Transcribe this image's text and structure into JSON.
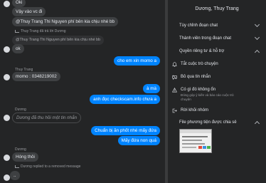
{
  "chat": {
    "messages": [
      {
        "text": "Oki"
      },
      {
        "text": "Vậy vào vc đi"
      },
      {
        "text": "@Thuy Trang Thi Nguyen phí bên kia chịu nhé bb"
      },
      {
        "meta": "Thuy Trang đã trả lời Dương"
      },
      {
        "quote": "@Thuy Trang Thi Nguyen phí bên kia chịu nhé bb"
      },
      {
        "text": "ok"
      },
      {
        "text": "cho em xin momo a"
      },
      {
        "sender": "Thuy Trang"
      },
      {
        "text": "momo : 0348219002"
      },
      {
        "text": "à mà"
      },
      {
        "text": "anh đọc checkscam.info chưa a"
      },
      {
        "sender": "Dương"
      },
      {
        "text": "Dương đã thu hồi một tin nhắn"
      },
      {
        "text": "Chuẩn bị ăn phốt nhé mấy đứa"
      },
      {
        "text": "Mấy đứa non quá"
      },
      {
        "sender": "Dương"
      },
      {
        "text": "Hóng thôi"
      },
      {
        "meta": "Dương replied to a removed message"
      },
      {
        "text": ".."
      }
    ]
  },
  "panel": {
    "title": "Dương, Thuy Trang",
    "sections": [
      {
        "label": "Tùy chỉnh đoạn chat"
      },
      {
        "label": "Thành viên trong đoạn chat"
      },
      {
        "label": "Quyền riêng tư & hỗ trợ"
      }
    ],
    "privacy_items": [
      {
        "label": "Tắt cuộc trò chuyện"
      },
      {
        "label": "Bỏ qua tin nhắn"
      },
      {
        "label": "Có gì đó không ổn",
        "sub": "Đóng góp ý kiến và báo cáo cuộc trò chuyện"
      },
      {
        "label": "Rời khỏi nhóm"
      }
    ],
    "media_section": {
      "label": "File phương tiện được chia sẻ"
    }
  },
  "colors": {
    "outgoing": "#0084ff",
    "incoming": "#3e4042",
    "background": "#242526"
  }
}
